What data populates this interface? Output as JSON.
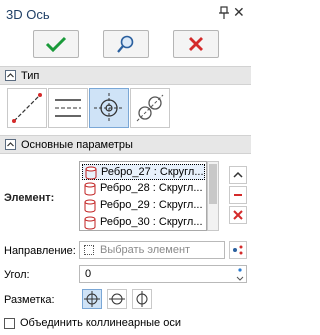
{
  "window": {
    "title": "3D Ось"
  },
  "sections": {
    "type": {
      "label": "Тип"
    },
    "main": {
      "label": "Основные параметры"
    }
  },
  "element": {
    "label": "Элемент:",
    "items": [
      "Ребро_27 : Скругл...",
      "Ребро_28 : Скругл...",
      "Ребро_29 : Скругл...",
      "Ребро_30 : Скругл..."
    ]
  },
  "direction": {
    "label": "Направление:",
    "placeholder": "Выбрать элемент"
  },
  "angle": {
    "label": "Угол:",
    "value": "0"
  },
  "marking": {
    "label": "Разметка:"
  },
  "merge": {
    "label": "Объединить коллинеарные оси",
    "checked": false
  },
  "colors": {
    "accent": "#2a7bd0",
    "ok": "#1a9a3a",
    "cancel": "#d42a2a",
    "selected_bg": "#cfe3f7"
  },
  "icons": [
    "pin-icon",
    "close-icon",
    "ok-icon",
    "preview-icon",
    "cancel-icon"
  ]
}
